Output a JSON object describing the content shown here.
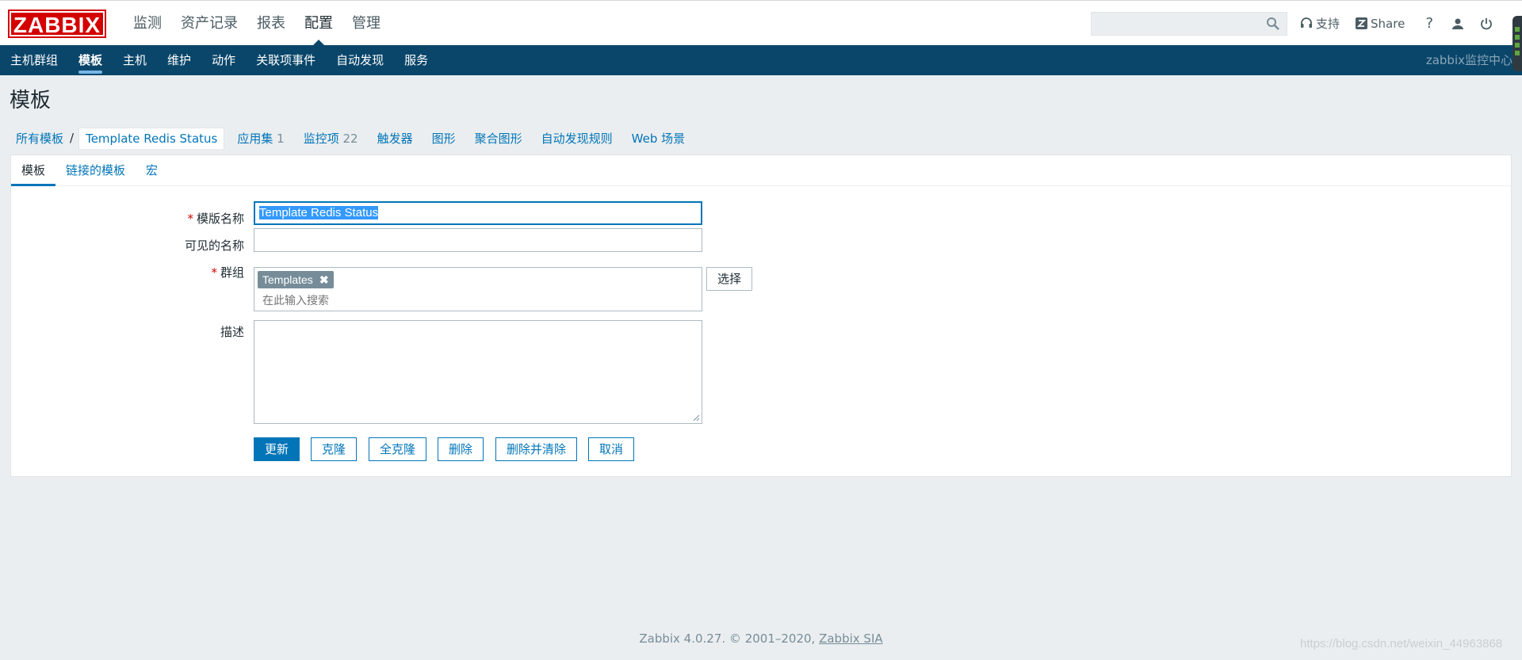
{
  "header": {
    "logo": "ZABBIX",
    "main_nav": [
      "监测",
      "资产记录",
      "报表",
      "配置",
      "管理"
    ],
    "active_main": 3,
    "search_placeholder": "",
    "support": "支持",
    "share": "Share",
    "help": "?"
  },
  "subnav": {
    "items": [
      "主机群组",
      "模板",
      "主机",
      "维护",
      "动作",
      "关联项事件",
      "自动发现",
      "服务"
    ],
    "active": 1,
    "right_text": "zabbix监控中心"
  },
  "page": {
    "title": "模板",
    "breadcrumb": {
      "all": "所有模板",
      "sep": "/",
      "current": "Template Redis Status",
      "tabs": [
        {
          "label": "应用集",
          "count": "1"
        },
        {
          "label": "监控项",
          "count": "22"
        },
        {
          "label": "触发器",
          "count": ""
        },
        {
          "label": "图形",
          "count": ""
        },
        {
          "label": "聚合图形",
          "count": ""
        },
        {
          "label": "自动发现规则",
          "count": ""
        },
        {
          "label": "Web 场景",
          "count": ""
        }
      ]
    },
    "form_tabs": [
      "模板",
      "链接的模板",
      "宏"
    ],
    "form": {
      "req_mark": "*",
      "name_label": "模版名称",
      "name_value": "Template Redis Status",
      "visible_label": "可见的名称",
      "visible_value": "",
      "group_label": "群组",
      "group_tag": "Templates",
      "group_search_placeholder": "在此输入搜索",
      "select_button": "选择",
      "desc_label": "描述",
      "desc_value": ""
    },
    "buttons": {
      "update": "更新",
      "clone": "克隆",
      "full_clone": "全克隆",
      "delete": "删除",
      "delete_clear": "删除并清除",
      "cancel": "取消"
    }
  },
  "footer": {
    "text": "Zabbix 4.0.27. © 2001–2020,",
    "link": "Zabbix SIA"
  },
  "watermark": "https://blog.csdn.net/weixin_44963868",
  "colors": {
    "brand_red": "#d40000",
    "nav_blue": "#0a466a",
    "link_blue": "#0275b8"
  }
}
